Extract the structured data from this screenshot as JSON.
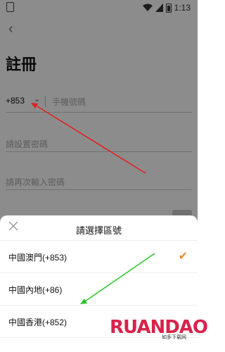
{
  "status_bar": {
    "time": "1:13"
  },
  "nav": {
    "back_icon": "chevron-left-icon"
  },
  "page": {
    "title": "註冊",
    "phone": {
      "code": "+853",
      "placeholder": "手機號碼"
    },
    "password_placeholder": "請設置密碼",
    "confirm_password_placeholder": "請再次輸入密碼"
  },
  "sheet": {
    "title": "請選擇區號",
    "options": [
      {
        "label": "中國澳門(+853)",
        "selected": true
      },
      {
        "label": "中國內地(+86)",
        "selected": false
      },
      {
        "label": "中國香港(+852)",
        "selected": false
      }
    ]
  },
  "watermark": {
    "main": "RUANDAO",
    "sub": "如多下载网"
  },
  "colors": {
    "accent": "#f08a24",
    "arrow_red": "#e02020",
    "arrow_green": "#2bc42b"
  }
}
